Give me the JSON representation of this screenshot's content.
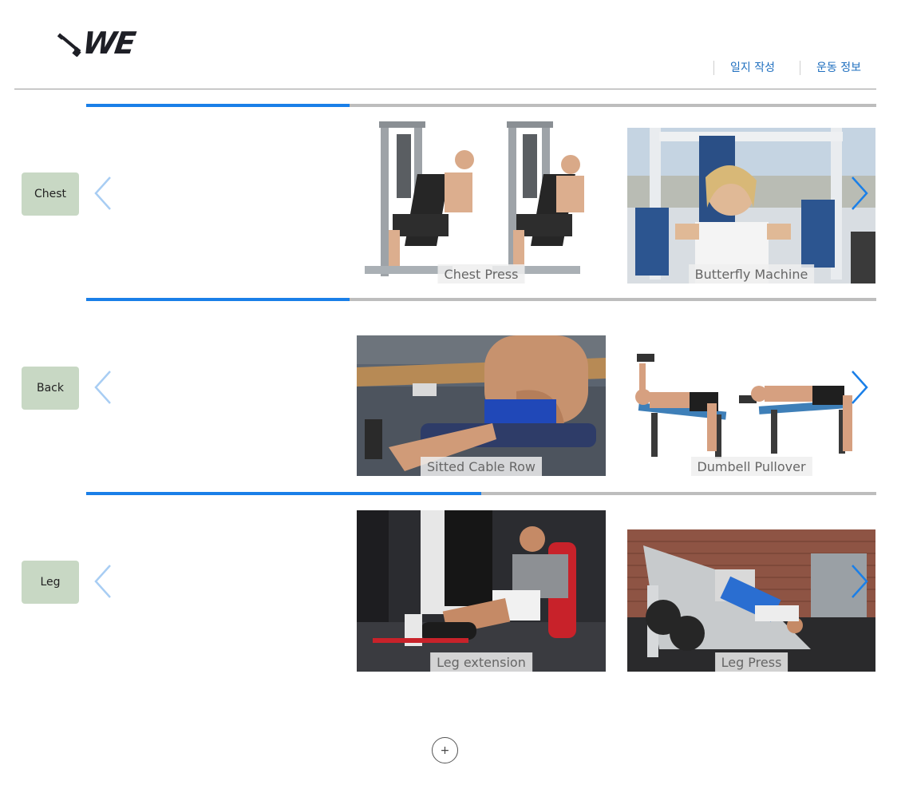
{
  "brand": {
    "logo_text": "WE",
    "logo_icon": "dumbbell-icon"
  },
  "nav": {
    "items": [
      {
        "label": "일지 작성"
      },
      {
        "label": "운동 정보"
      }
    ]
  },
  "colors": {
    "accent": "#1a7fe8",
    "track": "#bdbdbd",
    "category_bg": "#c8d8c4",
    "nav_text": "#1f6fbf"
  },
  "categories": [
    {
      "label": "Chest",
      "progress": 0.33,
      "exercises": [
        {
          "label": "Chest Press"
        },
        {
          "label": "Butterfly Machine"
        }
      ]
    },
    {
      "label": "Back",
      "progress": 0.33,
      "exercises": [
        {
          "label": "Sitted Cable Row"
        },
        {
          "label": "Dumbell Pullover"
        }
      ]
    },
    {
      "label": "Leg",
      "progress": 0.5,
      "exercises": [
        {
          "label": "Leg extension"
        },
        {
          "label": "Leg Press"
        }
      ]
    }
  ],
  "add_button": {
    "label": "+"
  }
}
